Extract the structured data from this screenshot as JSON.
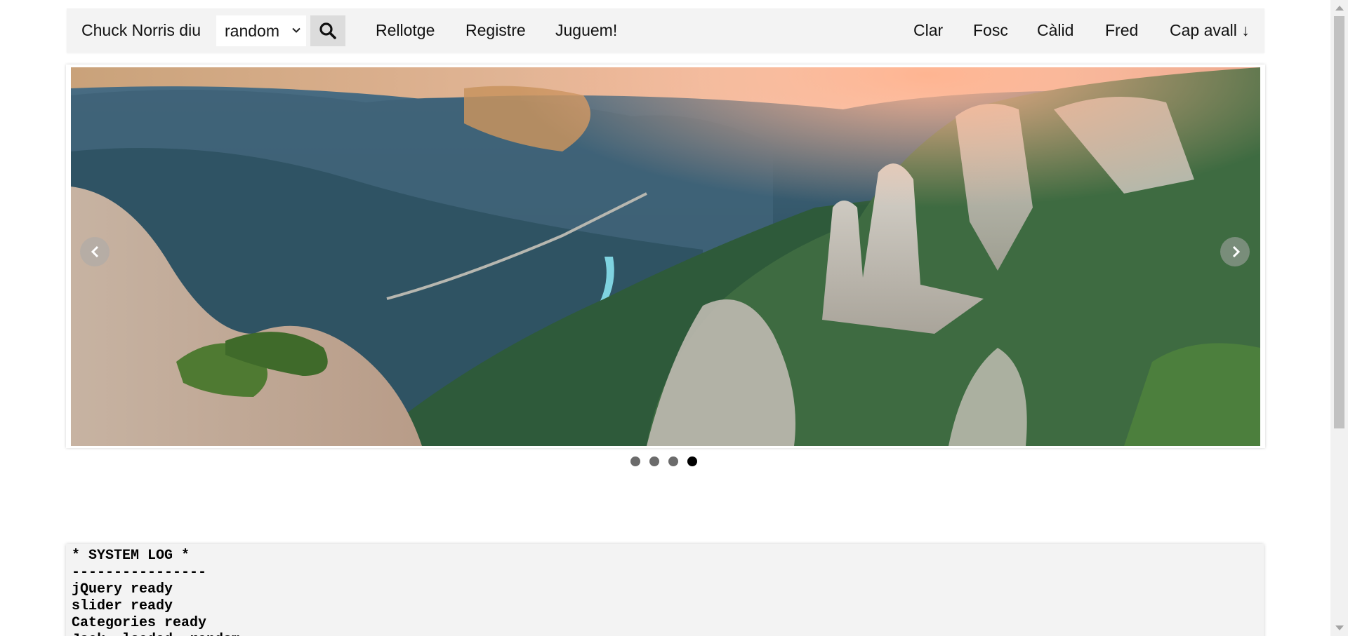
{
  "navbar": {
    "brand": "Chuck Norris diu",
    "joke_category": {
      "selected": "random"
    },
    "search_icon": "search-icon",
    "links": [
      "Rellotge",
      "Registre",
      "Juguem!"
    ],
    "themes": [
      "Clar",
      "Fosc",
      "Càlid",
      "Fred"
    ],
    "scroll_down": "Cap avall ↓"
  },
  "slider": {
    "image_description_icon": "mountain-landscape-photo",
    "prev_icon": "chevron-left-icon",
    "next_icon": "chevron-right-icon",
    "slide_count": 4,
    "active_slide": 4
  },
  "system_log": {
    "lines": [
      "* SYSTEM LOG *",
      "----------------",
      "jQuery ready",
      "slider ready",
      "Categories ready",
      "Jock  loaded  random"
    ]
  },
  "colors": {
    "navbar_bg": "#f3f3f3",
    "search_button_bg": "#dcdcdc",
    "dot_inactive": "#6b6b6b",
    "dot_active": "#000000"
  }
}
